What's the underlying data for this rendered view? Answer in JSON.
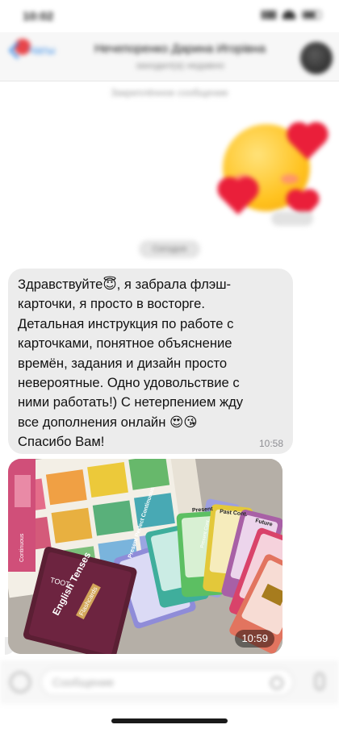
{
  "status_bar": {
    "time": "10:02"
  },
  "header": {
    "back_label": "Чаты",
    "contact_name": "Нечепоренко Дарина Игорівна",
    "contact_status": "заходил(а) недавно"
  },
  "pinned_note": "Закреплённое сообщение",
  "date_pill": "Сегодня",
  "message": {
    "text": "Здравствуйте😇, я забрала флэш-\nкарточки, я просто в восторге.\nДетальная инструкция по работе с\nкарточками, понятное объяснение\nвремён, задания и дизайн просто\nневероятные. Одно удовольствие с\nними работать!) С нетерпением жду\nвсе дополнения онлайн 😍😘\nСпасибо Вам!",
    "time": "10:58"
  },
  "photo": {
    "time": "10:59",
    "box_logo": "TOOT",
    "box_title": "English Tenses",
    "box_subtitle": "Flashcards",
    "card_labels": [
      "Present Perfect Continuous",
      "Present",
      "Present Cont.",
      "Past Cont.",
      "Future",
      "Continuous"
    ]
  },
  "input": {
    "placeholder": "Сообщение"
  },
  "colors": {
    "accent": "#3b8ee8",
    "bubble": "#ececec",
    "unread": "#e8454a"
  }
}
